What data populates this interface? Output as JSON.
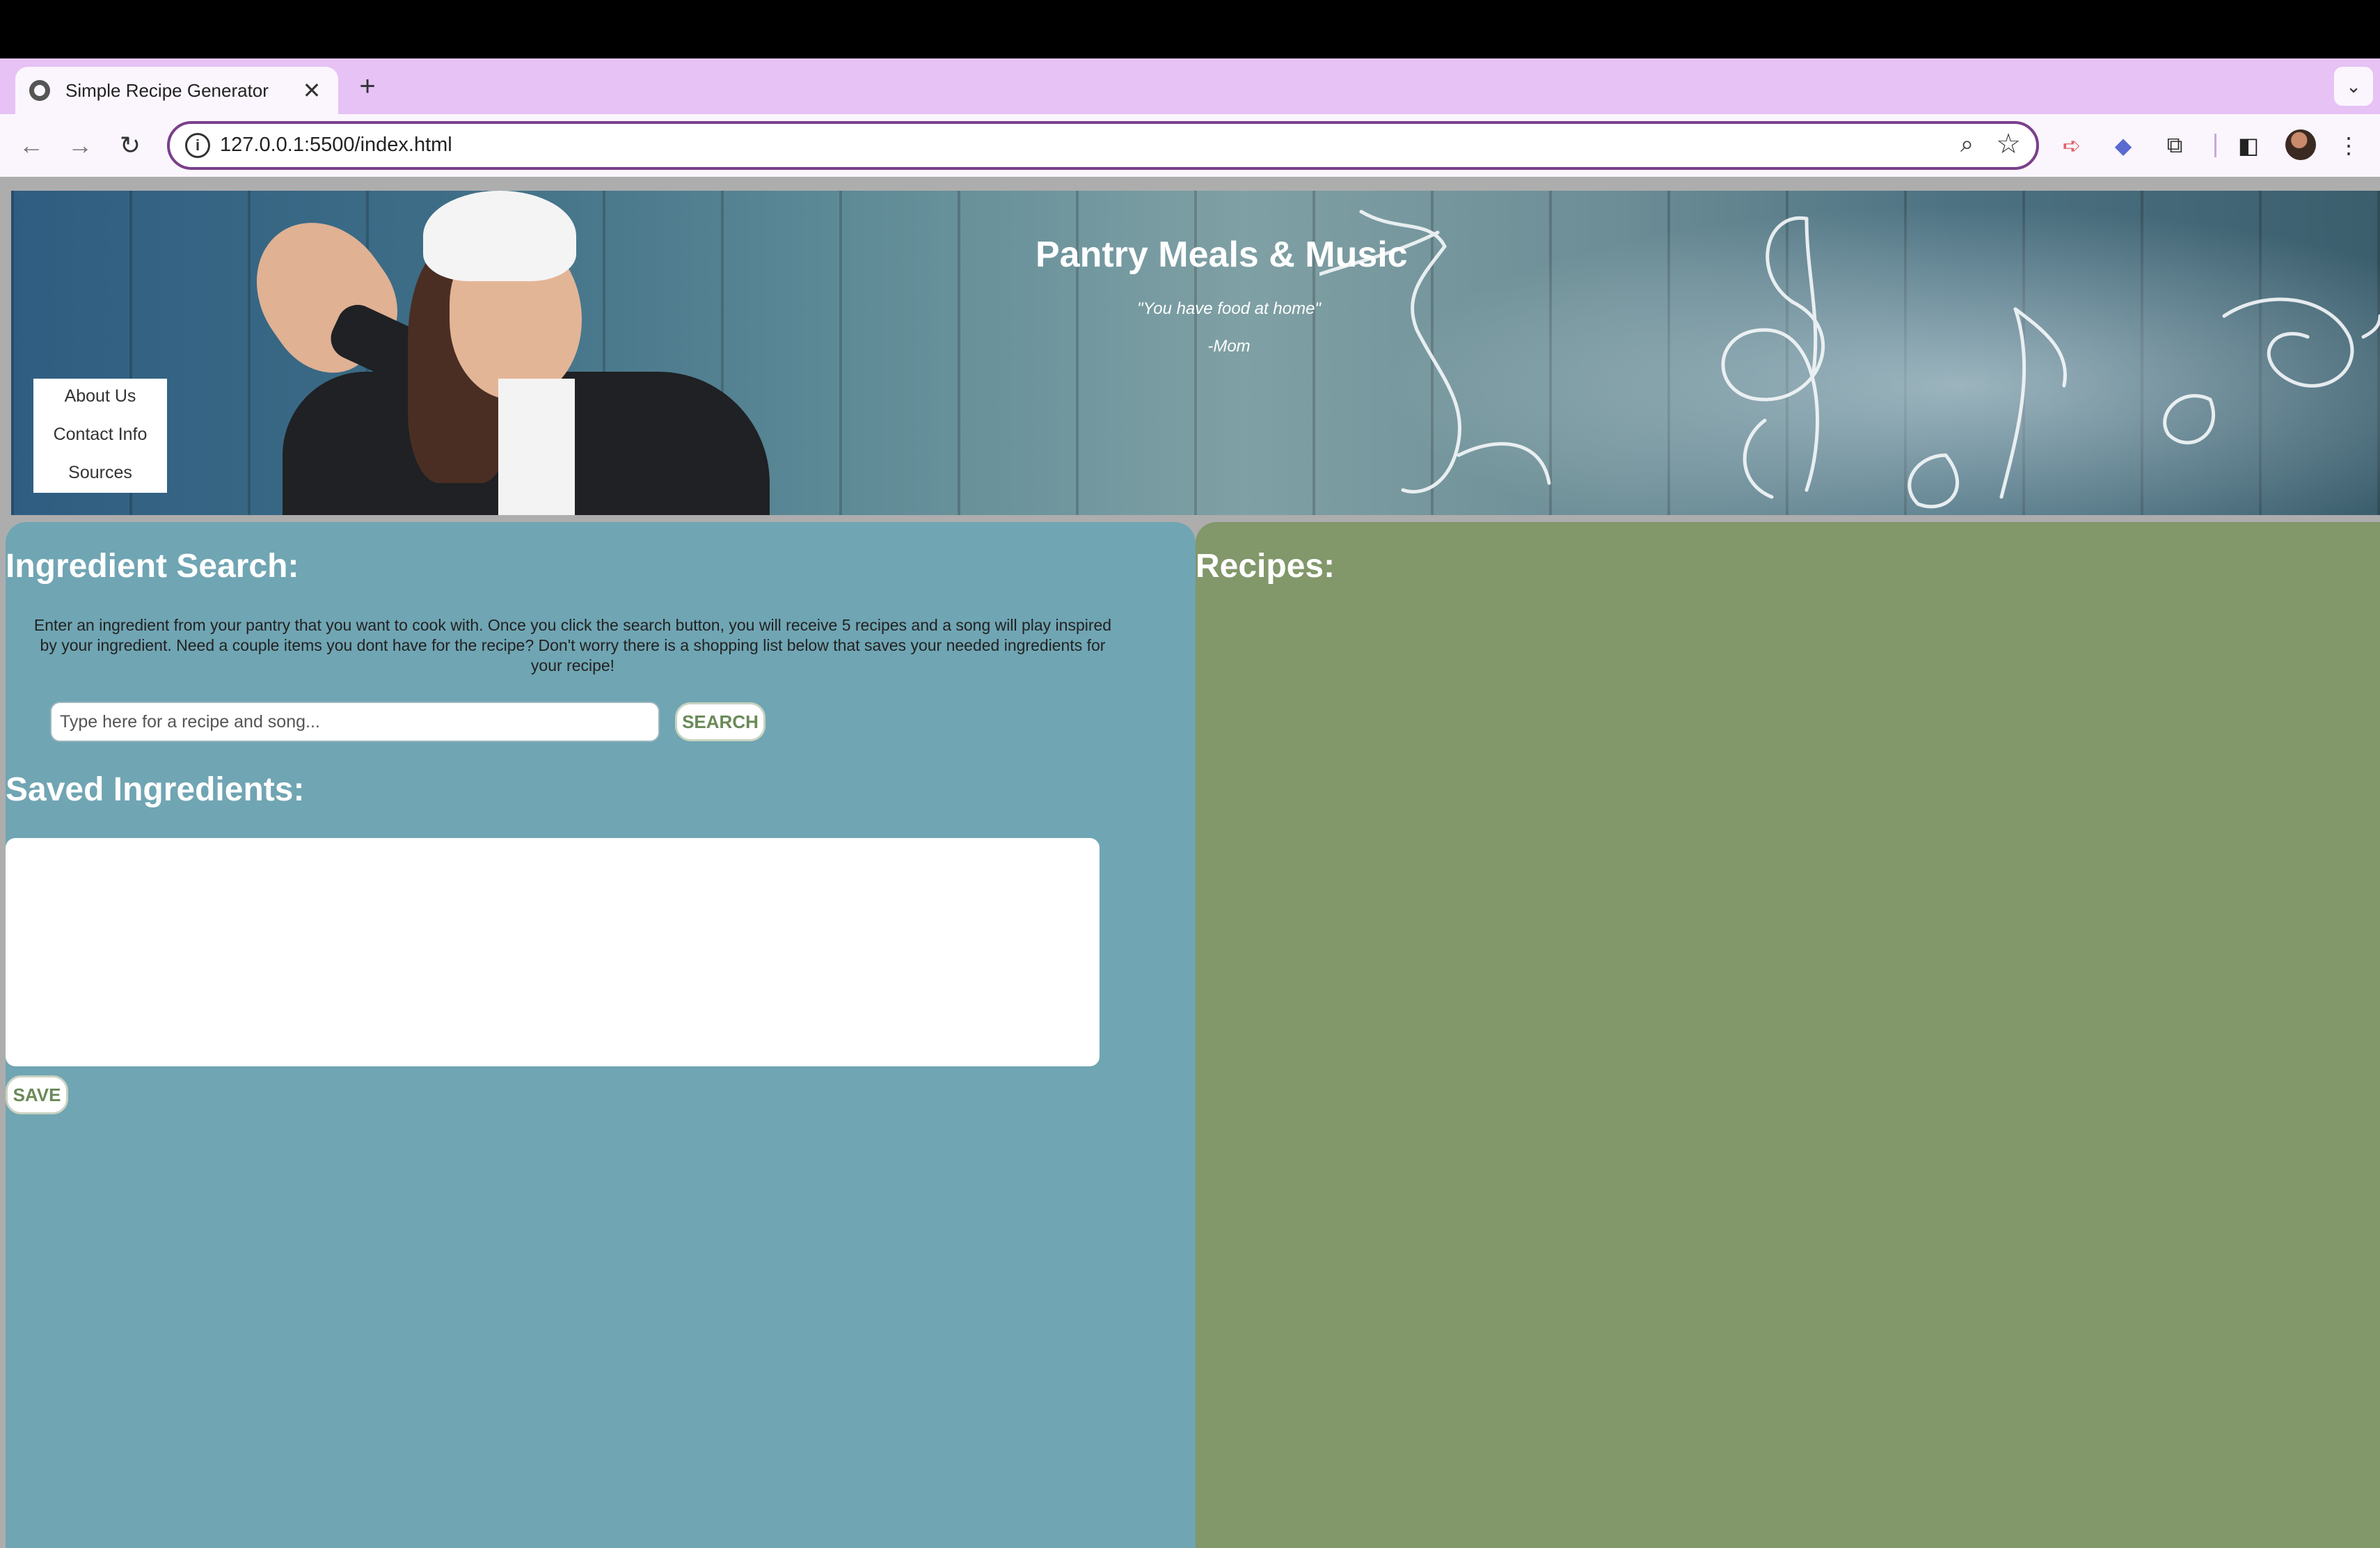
{
  "browser": {
    "tab_title": "Simple Recipe Generator",
    "tab_close": "✕",
    "new_tab": "+",
    "tab_menu": "⌄",
    "url": "127.0.0.1:5500/index.html",
    "icons": [
      "globe-icon",
      "close-icon",
      "plus-icon",
      "back-icon",
      "forward-icon",
      "reload-icon",
      "info-icon",
      "zoom-icon",
      "star-icon",
      "extension-icon",
      "puzzle-icon",
      "sidebar-icon",
      "profile-avatar",
      "more-icon"
    ]
  },
  "banner": {
    "title": "Pantry Meals & Music",
    "quote": "\"You have food at home\"",
    "attribution": "-Mom",
    "menu": [
      {
        "label": "About Us"
      },
      {
        "label": "Contact Info"
      },
      {
        "label": "Sources"
      }
    ]
  },
  "search": {
    "heading": "Ingredient Search:",
    "intro_lines": [
      "Enter an ingredient from your pantry that you want to cook with. Once you click the search button, you will receive 5 recipes and a song will play inspired",
      "by your ingredient. Need a couple items you dont have for the recipe? Don't worry there is a shopping list below that saves your needed ingredients for",
      "your recipe!"
    ],
    "placeholder": "Type here for a recipe and song...",
    "button_label": "SEARCH"
  },
  "saved": {
    "heading": "Saved Ingredients:",
    "value": "",
    "button_label": "SAVE"
  },
  "recipes": {
    "heading": "Recipes:"
  },
  "colors": {
    "tab_bar": "#e6c2f5",
    "left_panel": "#70a5b3",
    "right_panel": "#82976a",
    "button_text": "#6a8a58"
  }
}
